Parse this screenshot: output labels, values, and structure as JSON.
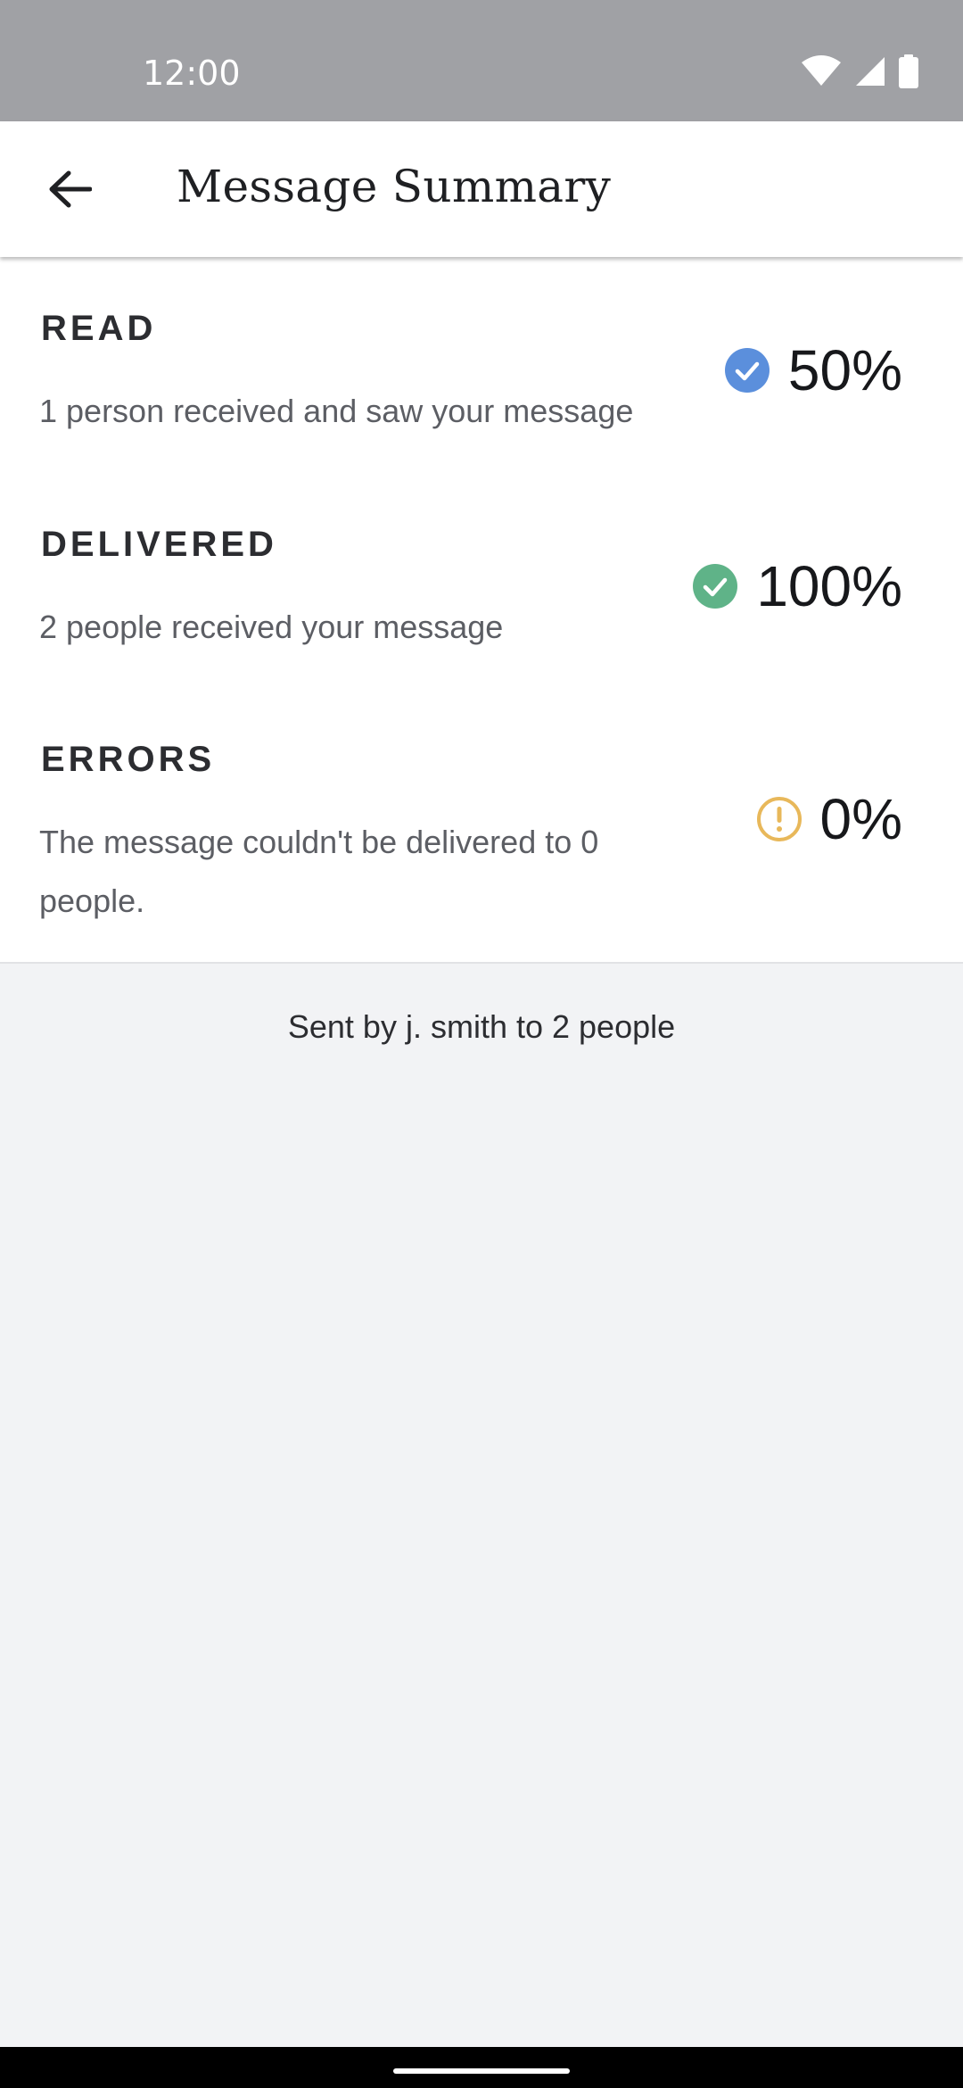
{
  "status_bar": {
    "time": "12:00",
    "icons": [
      "wifi-icon",
      "cell-signal-icon",
      "battery-icon"
    ]
  },
  "app_bar": {
    "back_icon": "arrow-left-icon",
    "title": "Message Summary"
  },
  "stats": {
    "read": {
      "label": "READ",
      "description": "1 person received and saw your message",
      "percent": "50%",
      "icon": "check-circle-icon",
      "color": "#5b8fdc"
    },
    "delivered": {
      "label": "DELIVERED",
      "description": "2 people received your message",
      "percent": "100%",
      "icon": "check-circle-icon",
      "color": "#5fb388"
    },
    "errors": {
      "label": "ERRORS",
      "description": "The message couldn't be delivered to 0 people.",
      "percent": "0%",
      "icon": "alert-circle-icon",
      "color": "#e8b85a"
    }
  },
  "footer": {
    "text": "Sent by j. smith to 2 people"
  }
}
